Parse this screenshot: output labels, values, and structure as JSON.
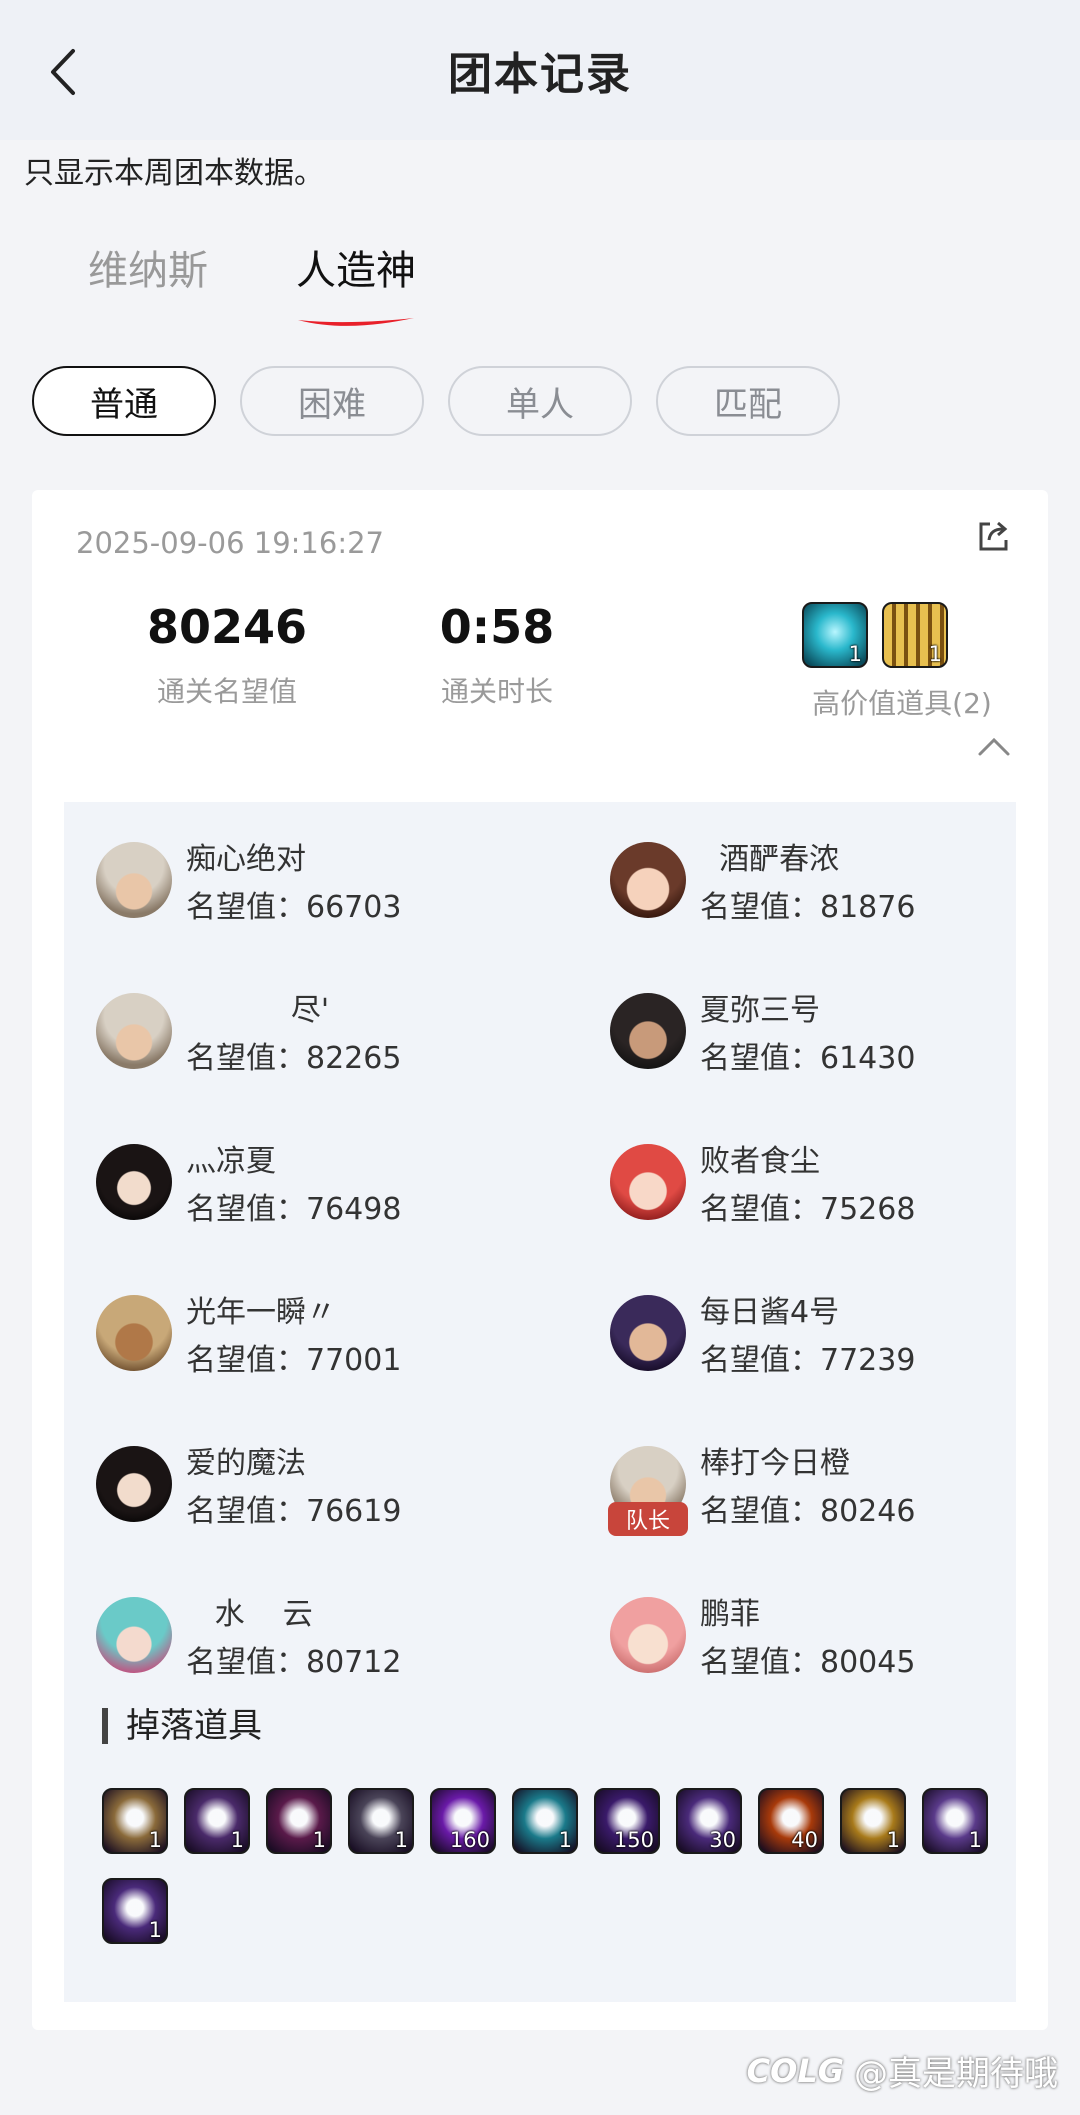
{
  "header": {
    "title": "团本记录"
  },
  "notice": "只显示本周团本数据。",
  "tabs": [
    {
      "label": "维纳斯",
      "active": false
    },
    {
      "label": "人造神",
      "active": true
    }
  ],
  "filters": [
    {
      "label": "普通",
      "active": true
    },
    {
      "label": "困难",
      "active": false
    },
    {
      "label": "单人",
      "active": false
    },
    {
      "label": "匹配",
      "active": false
    }
  ],
  "record": {
    "timestamp": "2025-09-06 19:16:27",
    "score": "80246",
    "score_label": "通关名望值",
    "time": "0:58",
    "time_label": "通关时长",
    "high_value_label": "高价值道具(2)",
    "high_value_items": [
      {
        "icon": "cyan-orb-icon",
        "qty": "1"
      },
      {
        "icon": "gold-chest-icon",
        "qty": "1"
      }
    ]
  },
  "members": [
    {
      "name": "痴心绝对",
      "score": "名望值：66703",
      "avatar": "avatar-silver-hair",
      "leader": false
    },
    {
      "name": "  酒酽春浓",
      "score": "名望值：81876",
      "avatar": "avatar-girl-brown",
      "leader": false
    },
    {
      "name": "           尽'",
      "score": "名望值：82265",
      "avatar": "avatar-silver-hair",
      "leader": false
    },
    {
      "name": "夏弥三号",
      "score": "名望值：61430",
      "avatar": "avatar-dark-man",
      "leader": false
    },
    {
      "name": "灬凉夏",
      "score": "名望值：76498",
      "avatar": "avatar-black-hair-woman",
      "leader": false
    },
    {
      "name": "败者食尘",
      "score": "名望值：75268",
      "avatar": "avatar-red-hair-elf",
      "leader": false
    },
    {
      "name": "光年一瞬〃",
      "score": "名望值：77001",
      "avatar": "avatar-tan-warrior",
      "leader": false
    },
    {
      "name": "每日酱4号",
      "score": "名望值：77239",
      "avatar": "avatar-purple-hair",
      "leader": false
    },
    {
      "name": "爱的魔法",
      "score": "名望值：76619",
      "avatar": "avatar-black-hair-woman",
      "leader": false
    },
    {
      "name": "棒打今日橙",
      "score": "名望值：80246",
      "avatar": "avatar-silver-hair",
      "leader": true,
      "leader_label": "队长"
    },
    {
      "name": "   水    云",
      "score": "名望值：80712",
      "avatar": "avatar-teal-hair",
      "leader": false
    },
    {
      "name": "鹏菲",
      "score": "名望值：80045",
      "avatar": "avatar-pink-hair",
      "leader": false
    }
  ],
  "drops_title": "掉落道具",
  "drops": [
    {
      "icon": "beige-armor-icon",
      "qty": "1",
      "color": "#8a6a3a"
    },
    {
      "icon": "purple-bracer-icon",
      "qty": "1",
      "color": "#4a2a6a"
    },
    {
      "icon": "purple-boot-icon",
      "qty": "1",
      "color": "#5a1a4a"
    },
    {
      "icon": "silver-gear-icon",
      "qty": "1",
      "color": "#4a4458"
    },
    {
      "icon": "purple-orb-icon",
      "qty": "160",
      "color": "#6a1aa8"
    },
    {
      "icon": "cyan-orb-icon",
      "qty": "1",
      "color": "#1a7a8a"
    },
    {
      "icon": "purple-crystal-icon",
      "qty": "150",
      "color": "#3a1a6a"
    },
    {
      "icon": "purple-swirl-icon",
      "qty": "30",
      "color": "#4a2a7a"
    },
    {
      "icon": "fire-ring-icon",
      "qty": "40",
      "color": "#a83a0a"
    },
    {
      "icon": "gold-chest-icon",
      "qty": "1",
      "color": "#a87a1a"
    },
    {
      "icon": "white-boot-icon",
      "qty": "1",
      "color": "#5a3a8a"
    },
    {
      "icon": "white-gauntlet-icon",
      "qty": "1",
      "color": "#4a2a7a"
    }
  ],
  "watermark": {
    "logo": "COLG",
    "text": "@真是期待哦"
  }
}
